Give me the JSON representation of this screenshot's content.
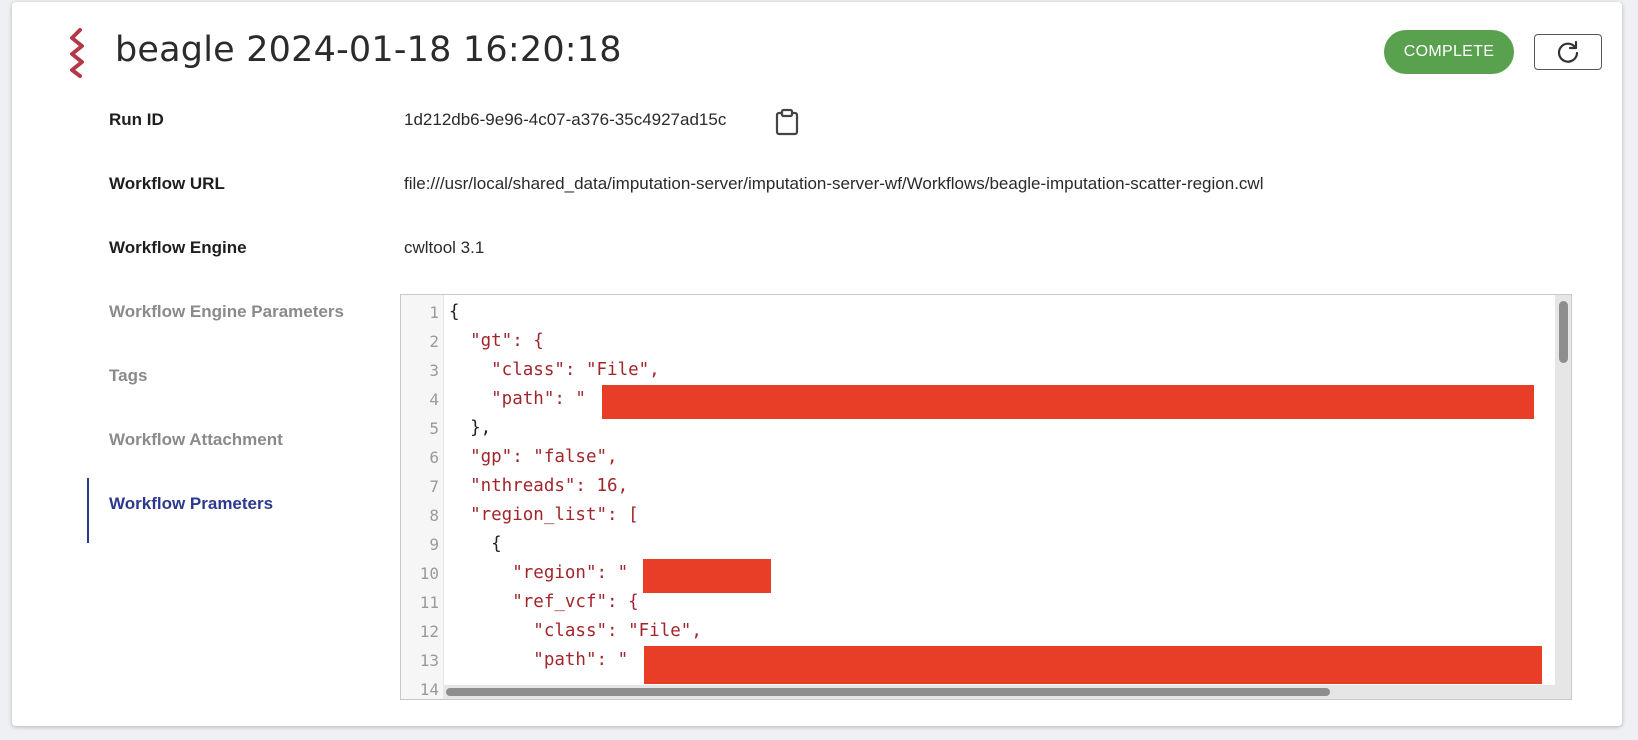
{
  "header": {
    "title": "beagle 2024-01-18 16:20:18",
    "status": "COMPLETE",
    "status_color": "#5aa14f",
    "refresh_icon": "refresh-icon",
    "logo_icon": "zigzag-logo-icon"
  },
  "fields": {
    "run_id": {
      "label": "Run ID",
      "value": "1d212db6-9e96-4c07-a376-35c4927ad15c",
      "copy_icon": "clipboard-icon"
    },
    "workflow_url": {
      "label": "Workflow URL",
      "value": "file:///usr/local/shared_data/imputation-server/imputation-server-wf/Workflows/beagle-imputation-scatter-region.cwl"
    },
    "workflow_engine": {
      "label": "Workflow Engine",
      "value": "cwltool 3.1"
    }
  },
  "nav": {
    "engine_params": "Workflow Engine Parameters",
    "tags": "Tags",
    "attachment": "Workflow Attachment",
    "params": "Workflow Prameters",
    "active_color": "#2b3a8f"
  },
  "editor": {
    "line_numbers": [
      "1",
      "2",
      "3",
      "4",
      "5",
      "6",
      "7",
      "8",
      "9",
      "10",
      "11",
      "12",
      "13",
      "14"
    ],
    "lines": [
      "{",
      "  \"gt\": {",
      "    \"class\": \"File\",",
      "    \"path\": \"",
      "  },",
      "  \"gp\": \"false\",",
      "  \"nthreads\": 16,",
      "  \"region_list\": [",
      "    {",
      "      \"region\": \"",
      "      \"ref_vcf\": {",
      "        \"class\": \"File\",",
      "        \"path\": \""
    ],
    "redaction_color": "#e83d27"
  }
}
